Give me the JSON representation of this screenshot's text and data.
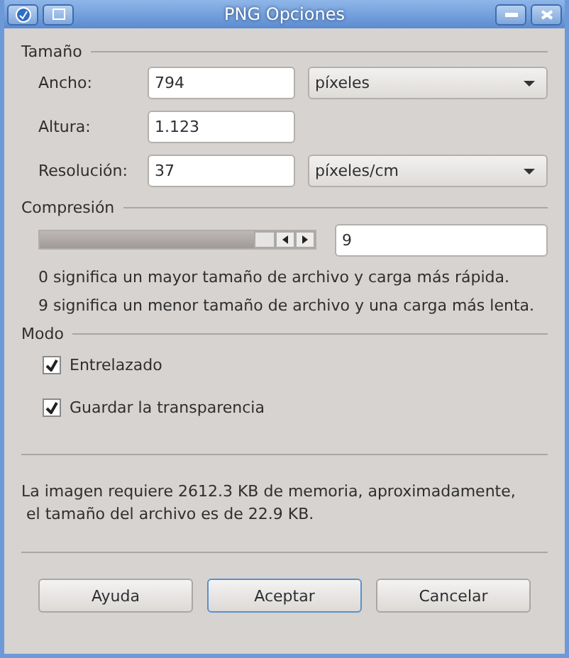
{
  "window": {
    "title": "PNG Opciones"
  },
  "size": {
    "title": "Tamaño",
    "rows": [
      {
        "label": "Ancho:",
        "value": "794",
        "unit": "píxeles"
      },
      {
        "label": "Altura:",
        "value": "1.123"
      },
      {
        "label": "Resolución:",
        "value": "37",
        "unit": "píxeles/cm"
      }
    ]
  },
  "compression": {
    "title": "Compresión",
    "level": 1,
    "value": "9",
    "notes": [
      "0 significa un mayor tamaño de archivo y carga más rápida.",
      "9 significa un menor tamaño de archivo y una carga más lenta."
    ]
  },
  "mode": {
    "title": "Modo",
    "options": [
      {
        "label": "Entrelazado",
        "checked": true
      },
      {
        "label": "Guardar la transparencia",
        "checked": true
      }
    ]
  },
  "info": [
    "La imagen requiere 2612.3 KB de memoria, aproximadamente,",
    " el tamaño del archivo es de 22.9 KB."
  ],
  "buttons": [
    {
      "label": "Ayuda",
      "default": false
    },
    {
      "label": "Aceptar",
      "default": true
    },
    {
      "label": "Cancelar",
      "default": false
    }
  ]
}
